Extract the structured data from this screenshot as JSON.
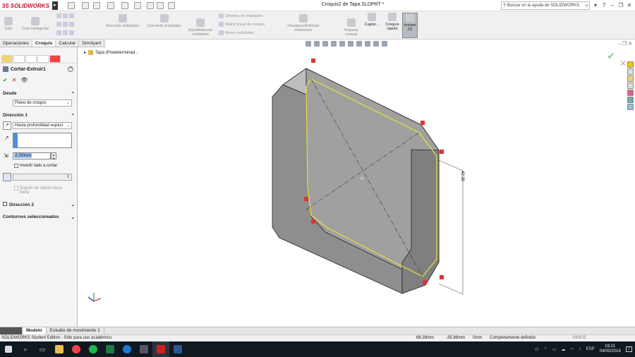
{
  "app": {
    "logo_ds": "3S",
    "logo_text": "SOLIDWORKS",
    "doc_title": "Croquis2 de Tapa.SLDPRT *",
    "help_placeholder": "Buscar en la ayuda de SOLIDWORKS"
  },
  "ribbon": {
    "salir": "Salir",
    "cota_inteligente": "Cota inteligente",
    "recortar": "Recortar entidades",
    "convertir": "Convertir entidades",
    "equidistanciar": "Equidistanciar entidades",
    "simetria": "Simetría de entidades",
    "matriz": "Matriz lineal de croquis",
    "mover": "Mover entidades",
    "visualizar": "Visualizar/Eliminar relaciones",
    "reparar": "Reparar croquis",
    "captura": "Captur...",
    "croquis_rapido": "Croquis rápido",
    "instant2d": "Instant 2D"
  },
  "tabs": [
    "Operaciones",
    "Croquis",
    "Calcular",
    "DimXpert"
  ],
  "active_tab": "Croquis",
  "panel": {
    "feature_title": "Cortar-Extruir1",
    "desde_label": "Desde",
    "desde_value": "Plano de croquis",
    "dir1_label": "Dirección 1",
    "dir1_type": "Hasta profundidad especi",
    "depth": "2.00mm",
    "invert": "Invertir lado a cortar",
    "draft": "Ángulo de salida hacia fuera",
    "dir2_label": "Dirección 2",
    "contours_label": "Contornos seleccionados"
  },
  "viewport": {
    "tree_item": "Tapa  (Predeterminad..."
  },
  "bottom_tabs": [
    "Modelo",
    "Estudio de movimiento 1"
  ],
  "status": {
    "edition": "SOLIDWORKS Student Edition - Sólo para uso académico",
    "x": "68.39mm",
    "y": "-35.86mm",
    "z": "0mm",
    "state": "Completamente definido",
    "units": "MMGS"
  },
  "taskbar": {
    "lang": "ESP",
    "time": "19:21",
    "date": "04/05/2018",
    "notif": "7"
  },
  "dims": {
    "d1": "42.30"
  }
}
